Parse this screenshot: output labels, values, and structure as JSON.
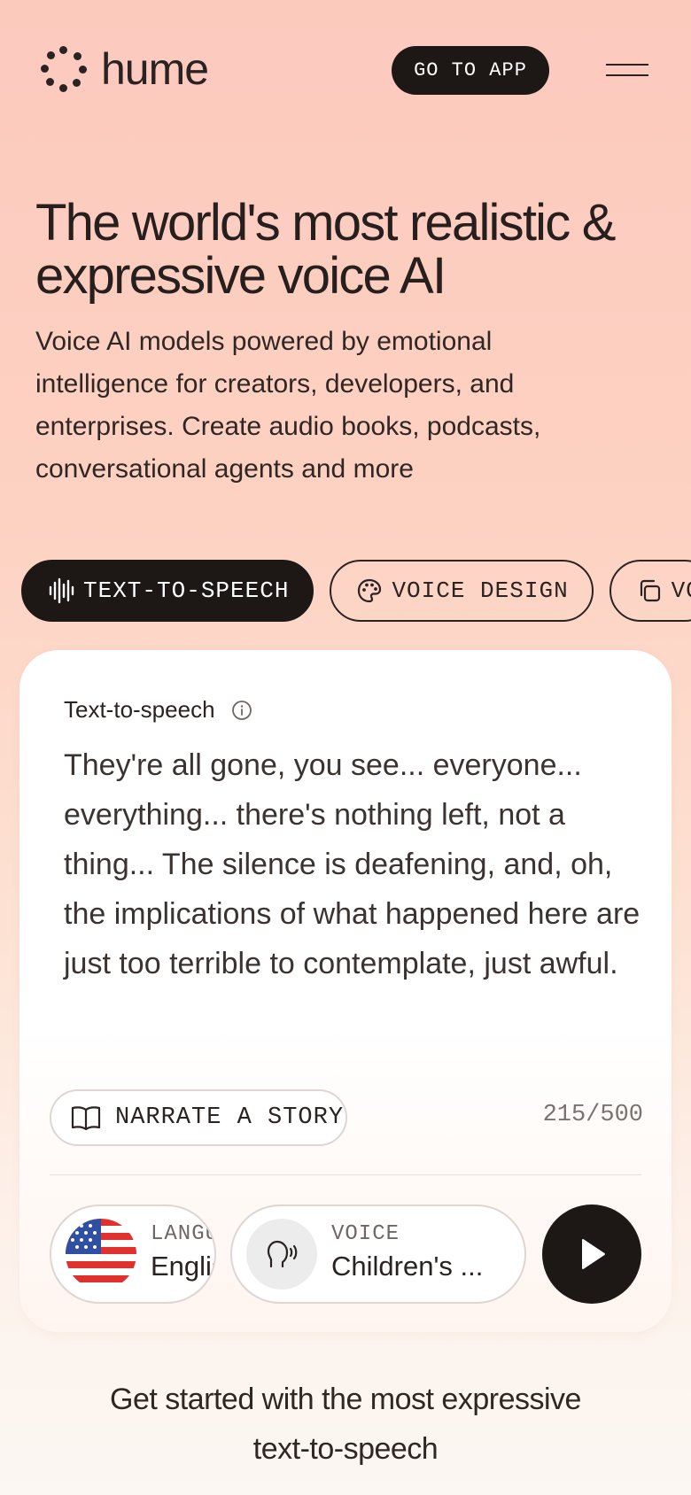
{
  "header": {
    "logo_text": "hume",
    "go_to_app_label": "GO TO APP"
  },
  "hero": {
    "title": "The world's most realistic & expressive voice AI",
    "subtitle": "Voice AI models powered by emotional intelligence for creators, developers, and enterprises. Create audio books, podcasts, conversational agents and more"
  },
  "tabs": [
    {
      "label": "TEXT-TO-SPEECH",
      "icon": "waveform-icon",
      "active": true
    },
    {
      "label": "VOICE DESIGN",
      "icon": "palette-icon",
      "active": false
    },
    {
      "label": "VOICE CLONING",
      "icon": "copy-icon",
      "active": false
    }
  ],
  "card": {
    "label": "Text-to-speech",
    "text": "They're all gone, you see... everyone... everything... there's nothing left, not a thing... The silence is deafening, and, oh, the implications of what happened here are just too terrible to contemplate, just awful.",
    "narrate_label": "NARRATE A STORY",
    "char_count": "215/500",
    "language": {
      "label": "LANGUAGE",
      "value": "English"
    },
    "voice": {
      "label": "VOICE",
      "value": "Children's ..."
    }
  },
  "cta": {
    "text": "Get started with the most expressive text-to-speech"
  },
  "colors": {
    "dark": "#1d1816",
    "background_top": "#fcc9bd",
    "background_bottom": "#fcf7f3"
  }
}
